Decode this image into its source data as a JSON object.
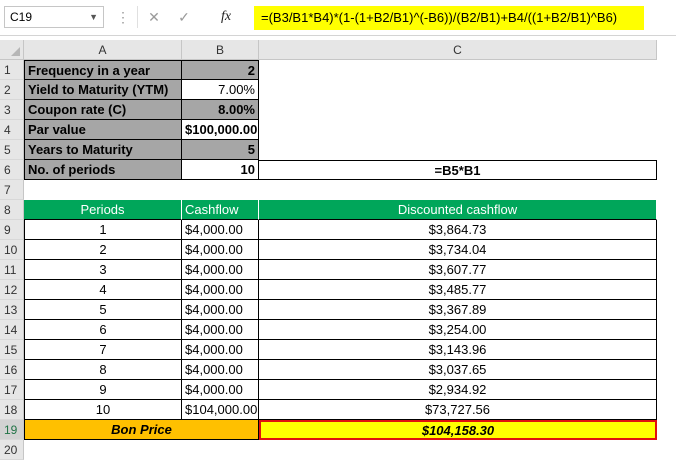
{
  "formula_bar": {
    "name_box": "C19",
    "cancel_icon": "✕",
    "enter_icon": "✓",
    "fx_label": "fx",
    "formula": "=(B3/B1*B4)*(1-(1+B2/B1)^(-B6))/(B2/B1)+B4/((1+B2/B1)^B6)"
  },
  "columns": [
    "A",
    "B",
    "C"
  ],
  "rows": [
    "1",
    "2",
    "3",
    "4",
    "5",
    "6",
    "7",
    "8",
    "9",
    "10",
    "11",
    "12",
    "13",
    "14",
    "15",
    "16",
    "17",
    "18",
    "19",
    "20"
  ],
  "inputs": [
    {
      "label": "Frequency in a year",
      "value": "2"
    },
    {
      "label": "Yield to Maturity (YTM)",
      "value": "7.00%"
    },
    {
      "label": "Coupon rate (C)",
      "value": "8.00%"
    },
    {
      "label": "Par value",
      "value": "$100,000.00"
    },
    {
      "label": "Years to Maturity",
      "value": "5"
    },
    {
      "label": "No. of periods",
      "value": "10",
      "formula_note": "=B5*B1"
    }
  ],
  "table": {
    "headers": [
      "Periods",
      "Cashflow",
      "Discounted cashflow"
    ],
    "rows": [
      [
        "1",
        "$4,000.00",
        "$3,864.73"
      ],
      [
        "2",
        "$4,000.00",
        "$3,734.04"
      ],
      [
        "3",
        "$4,000.00",
        "$3,607.77"
      ],
      [
        "4",
        "$4,000.00",
        "$3,485.77"
      ],
      [
        "5",
        "$4,000.00",
        "$3,367.89"
      ],
      [
        "6",
        "$4,000.00",
        "$3,254.00"
      ],
      [
        "7",
        "$4,000.00",
        "$3,143.96"
      ],
      [
        "8",
        "$4,000.00",
        "$3,037.65"
      ],
      [
        "9",
        "$4,000.00",
        "$2,934.92"
      ],
      [
        "10",
        "$104,000.00",
        "$73,727.56"
      ]
    ],
    "total_label": "Bon Price",
    "total_value": "$104,158.30"
  },
  "colors": {
    "input_fill": "#a6a6a6",
    "header_fill": "#00a65a",
    "total_label_fill": "#ffc000",
    "total_value_fill": "#ffff00",
    "selection_border": "#e01010"
  }
}
